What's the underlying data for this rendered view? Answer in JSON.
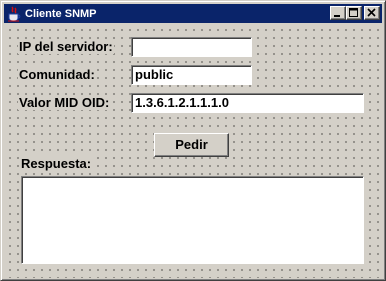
{
  "window": {
    "title": "Cliente SNMP",
    "controls": [
      "minimize",
      "maximize",
      "close"
    ]
  },
  "form": {
    "ip_label": "IP del servidor:",
    "ip_value": "",
    "community_label": "Comunidad:",
    "community_value": "public",
    "oid_label": "Valor MID OID:",
    "oid_value": "1.3.6.1.2.1.1.1.0",
    "submit_label": "Pedir",
    "response_label": "Respuesta:",
    "response_value": ""
  },
  "colors": {
    "titlebar": "#0a246a",
    "face": "#d4d0c8"
  },
  "icons": [
    "java-cup-icon",
    "minimize-icon",
    "maximize-icon",
    "close-icon"
  ]
}
